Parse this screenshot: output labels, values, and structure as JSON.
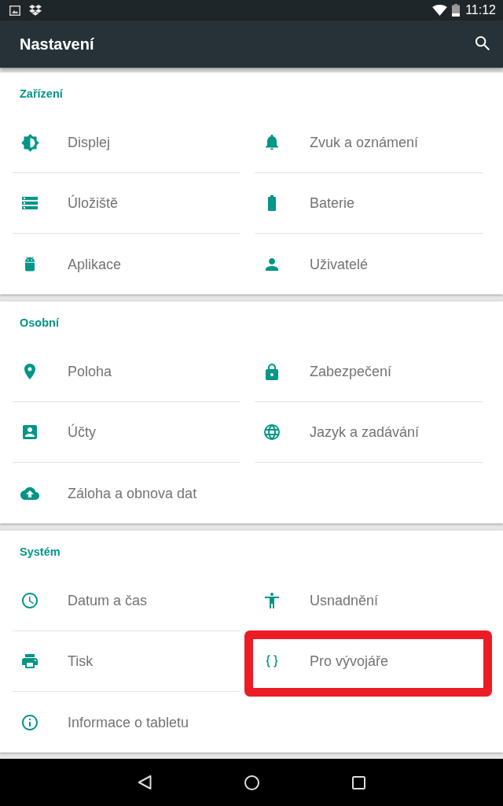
{
  "status_bar": {
    "time": "11:12"
  },
  "app_bar": {
    "title": "Nastavení"
  },
  "sections": [
    {
      "title": "Zařízení",
      "items": [
        {
          "label": "Displej",
          "highlighted": false
        },
        {
          "label": "Zvuk a oznámení",
          "highlighted": false
        },
        {
          "label": "Úložiště",
          "highlighted": false
        },
        {
          "label": "Baterie",
          "highlighted": false
        },
        {
          "label": "Aplikace",
          "highlighted": false
        },
        {
          "label": "Uživatelé",
          "highlighted": false
        }
      ]
    },
    {
      "title": "Osobní",
      "items": [
        {
          "label": "Poloha",
          "highlighted": false
        },
        {
          "label": "Zabezpečení",
          "highlighted": false
        },
        {
          "label": "Účty",
          "highlighted": false
        },
        {
          "label": "Jazyk a zadávání",
          "highlighted": false
        },
        {
          "label": "Záloha a obnova dat",
          "highlighted": false
        }
      ]
    },
    {
      "title": "Systém",
      "items": [
        {
          "label": "Datum a čas",
          "highlighted": false
        },
        {
          "label": "Usnadnění",
          "highlighted": false
        },
        {
          "label": "Tisk",
          "highlighted": false
        },
        {
          "label": "Pro vývojáře",
          "highlighted": true
        },
        {
          "label": "Informace o tabletu",
          "highlighted": false
        }
      ]
    }
  ]
}
